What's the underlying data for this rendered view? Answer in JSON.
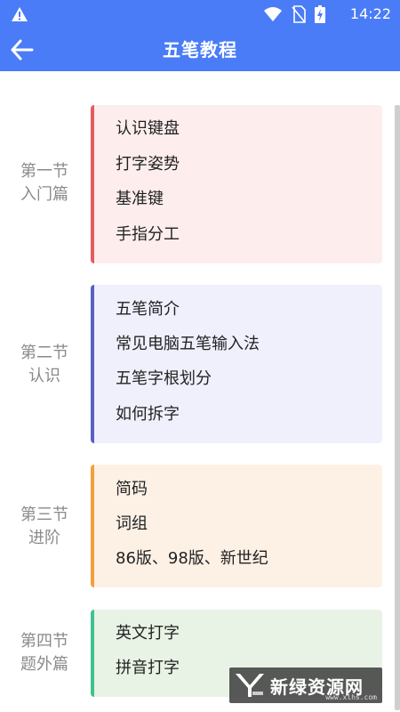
{
  "status_bar": {
    "time": "14:22"
  },
  "app_bar": {
    "title": "五笔教程"
  },
  "sections": [
    {
      "label_line1": "第一节",
      "label_line2": "入门篇",
      "accent": "#e35d5d",
      "bg": "#fdeeed",
      "items": [
        "认识键盘",
        "打字姿势",
        "基准键",
        "手指分工"
      ]
    },
    {
      "label_line1": "第二节",
      "label_line2": "认识",
      "accent": "#5660c4",
      "bg": "#eff0fc",
      "items": [
        "五笔简介",
        "常见电脑五笔输入法",
        "五笔字根划分",
        "如何拆字"
      ]
    },
    {
      "label_line1": "第三节",
      "label_line2": "进阶",
      "accent": "#f4a03b",
      "bg": "#fdf1e6",
      "items": [
        "简码",
        "词组",
        "86版、98版、新世纪"
      ]
    },
    {
      "label_line1": "第四节",
      "label_line2": "题外篇",
      "accent": "#3ec28f",
      "bg": "#e8f3e6",
      "items": [
        "英文打字",
        "拼音打字"
      ]
    }
  ],
  "watermark": {
    "text": "新绿资源网",
    "url": "www.xlhs.com"
  },
  "colors": {
    "primary": "#4a7cf7"
  }
}
